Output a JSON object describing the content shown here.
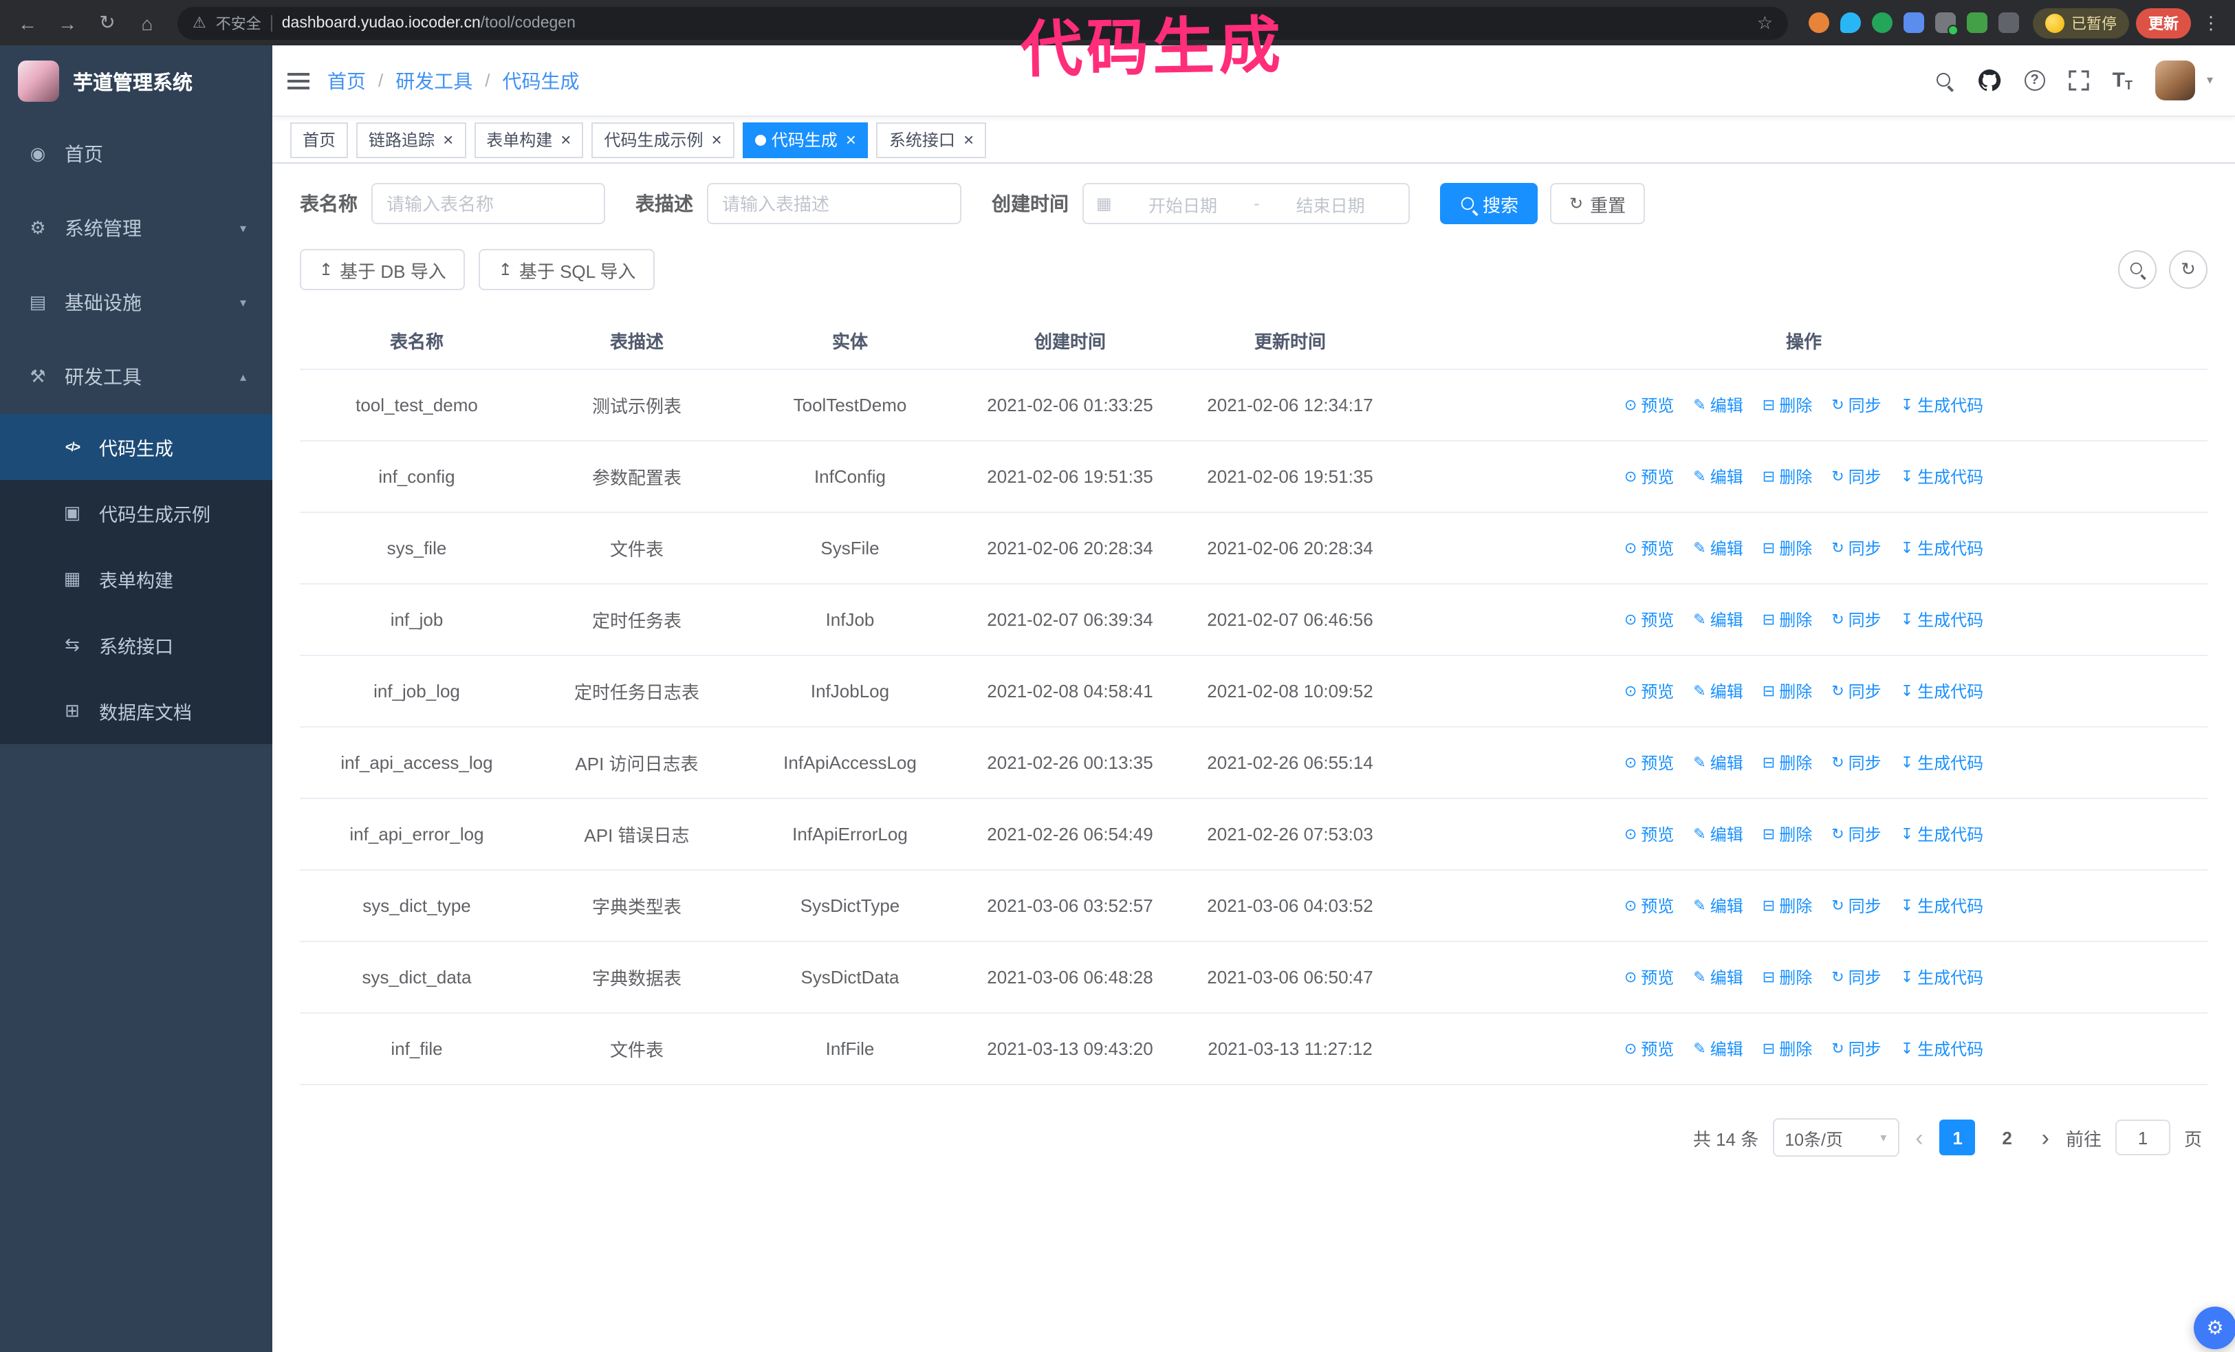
{
  "chrome": {
    "security_label": "不安全",
    "url_host": "dashboard.yudao.iocoder.cn",
    "url_path": "/tool/codegen",
    "paused_badge": "已暂停",
    "update_button": "更新"
  },
  "annotation": {
    "text": "代码生成",
    "color": "#ff2d7a"
  },
  "sidebar": {
    "logo_text": "芋道管理系统",
    "items": [
      {
        "label": "首页"
      },
      {
        "label": "系统管理"
      },
      {
        "label": "基础设施"
      },
      {
        "label": "研发工具"
      }
    ],
    "submenu": [
      {
        "label": "代码生成",
        "active": true
      },
      {
        "label": "代码生成示例"
      },
      {
        "label": "表单构建"
      },
      {
        "label": "系统接口"
      },
      {
        "label": "数据库文档"
      }
    ]
  },
  "header": {
    "breadcrumb": [
      "首页",
      "研发工具",
      "代码生成"
    ]
  },
  "tabs": [
    {
      "label": "首页",
      "closable": false,
      "active": false
    },
    {
      "label": "链路追踪",
      "closable": true,
      "active": false
    },
    {
      "label": "表单构建",
      "closable": true,
      "active": false
    },
    {
      "label": "代码生成示例",
      "closable": true,
      "active": false
    },
    {
      "label": "代码生成",
      "closable": true,
      "active": true
    },
    {
      "label": "系统接口",
      "closable": true,
      "active": false
    }
  ],
  "search_form": {
    "table_name_label": "表名称",
    "table_name_placeholder": "请输入表名称",
    "table_desc_label": "表描述",
    "table_desc_placeholder": "请输入表描述",
    "create_time_label": "创建时间",
    "start_placeholder": "开始日期",
    "range_separator": "-",
    "end_placeholder": "结束日期",
    "search_button": "搜索",
    "reset_button": "重置"
  },
  "toolbar": {
    "import_db_button": "基于 DB 导入",
    "import_sql_button": "基于 SQL 导入"
  },
  "table": {
    "columns": [
      "表名称",
      "表描述",
      "实体",
      "创建时间",
      "更新时间",
      "操作"
    ],
    "actions": [
      "预览",
      "编辑",
      "删除",
      "同步",
      "生成代码"
    ],
    "rows": [
      {
        "name": "tool_test_demo",
        "desc": "测试示例表",
        "entity": "ToolTestDemo",
        "created": "2021-02-06 01:33:25",
        "updated": "2021-02-06 12:34:17"
      },
      {
        "name": "inf_config",
        "desc": "参数配置表",
        "entity": "InfConfig",
        "created": "2021-02-06 19:51:35",
        "updated": "2021-02-06 19:51:35"
      },
      {
        "name": "sys_file",
        "desc": "文件表",
        "entity": "SysFile",
        "created": "2021-02-06 20:28:34",
        "updated": "2021-02-06 20:28:34"
      },
      {
        "name": "inf_job",
        "desc": "定时任务表",
        "entity": "InfJob",
        "created": "2021-02-07 06:39:34",
        "updated": "2021-02-07 06:46:56"
      },
      {
        "name": "inf_job_log",
        "desc": "定时任务日志表",
        "entity": "InfJobLog",
        "created": "2021-02-08 04:58:41",
        "updated": "2021-02-08 10:09:52"
      },
      {
        "name": "inf_api_access_log",
        "desc": "API 访问日志表",
        "entity": "InfApiAccessLog",
        "created": "2021-02-26 00:13:35",
        "updated": "2021-02-26 06:55:14"
      },
      {
        "name": "inf_api_error_log",
        "desc": "API 错误日志",
        "entity": "InfApiErrorLog",
        "created": "2021-02-26 06:54:49",
        "updated": "2021-02-26 07:53:03"
      },
      {
        "name": "sys_dict_type",
        "desc": "字典类型表",
        "entity": "SysDictType",
        "created": "2021-03-06 03:52:57",
        "updated": "2021-03-06 04:03:52"
      },
      {
        "name": "sys_dict_data",
        "desc": "字典数据表",
        "entity": "SysDictData",
        "created": "2021-03-06 06:48:28",
        "updated": "2021-03-06 06:50:47"
      },
      {
        "name": "inf_file",
        "desc": "文件表",
        "entity": "InfFile",
        "created": "2021-03-13 09:43:20",
        "updated": "2021-03-13 11:27:12"
      }
    ]
  },
  "pagination": {
    "total": "共 14 条",
    "page_size": "10条/页",
    "pages": [
      "1",
      "2"
    ],
    "current": "1",
    "goto_label": "前往",
    "goto_value": "1",
    "page_suffix": "页"
  },
  "colors": {
    "primary": "#1890ff",
    "sidebar_bg": "#304156",
    "submenu_bg": "#1f2d3d",
    "annotation": "#ff2d7a"
  }
}
